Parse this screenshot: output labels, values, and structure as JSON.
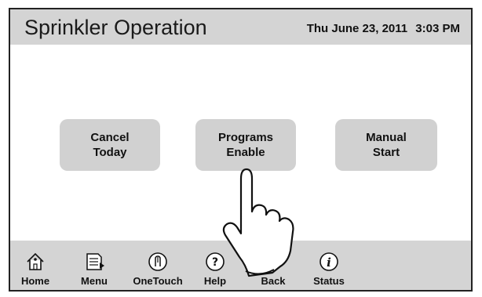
{
  "header": {
    "title": "Sprinkler Operation",
    "date": "Thu June 23, 2011",
    "time": "3:03 PM"
  },
  "buttons": {
    "cancel": {
      "line1": "Cancel",
      "line2": "Today"
    },
    "programs": {
      "line1": "Programs",
      "line2": "Enable"
    },
    "manual": {
      "line1": "Manual",
      "line2": "Start"
    }
  },
  "footer": {
    "items": [
      {
        "label": "Home",
        "icon": "home-icon"
      },
      {
        "label": "Menu",
        "icon": "menu-icon"
      },
      {
        "label": "OneTouch",
        "icon": "onetouch-icon"
      },
      {
        "label": "Help",
        "icon": "help-icon"
      },
      {
        "label": "Back",
        "icon": "back-icon"
      },
      {
        "label": "Status",
        "icon": "status-icon"
      }
    ]
  },
  "colors": {
    "bar": "#d4d4d4",
    "button": "#d1d1d1",
    "border": "#222222"
  }
}
